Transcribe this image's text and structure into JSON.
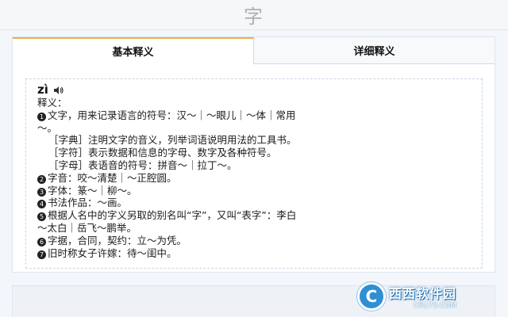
{
  "header": {
    "title": "字"
  },
  "tabs": [
    {
      "label": "基本释义",
      "active": true
    },
    {
      "label": "详细释义",
      "active": false
    }
  ],
  "entry": {
    "pinyin": "zì",
    "sound_icon": "speaker-icon",
    "definition_label": "释义：",
    "lines": [
      {
        "num": "1",
        "text": "文字，用来记录语言的符号：汉～｜～眼儿｜～体｜常用"
      },
      {
        "num": "",
        "text": "～。"
      },
      {
        "num": "",
        "sub": true,
        "text": "［字典］注明文字的音义，列举词语说明用法的工具书。"
      },
      {
        "num": "",
        "sub": true,
        "text": "［字符］表示数据和信息的字母、数字及各种符号。"
      },
      {
        "num": "",
        "sub": true,
        "text": "［字母］表语音的符号：拼音～｜拉丁～。"
      },
      {
        "num": "2",
        "text": "字音：咬～清楚｜～正腔圆。"
      },
      {
        "num": "3",
        "text": "字体：篆～｜柳～。"
      },
      {
        "num": "4",
        "text": "书法作品：～画。"
      },
      {
        "num": "5",
        "text": "根据人名中的字义另取的别名叫“字”，又叫“表字”：李白"
      },
      {
        "num": "",
        "text": "～太白｜岳飞～鹏举。"
      },
      {
        "num": "6",
        "text": "字据，合同，契约：立～为凭。"
      },
      {
        "num": "7",
        "text": "旧时称女子许嫁：待～闺中。"
      }
    ]
  },
  "watermark": {
    "logo_letter": "C",
    "main": "西西软件园",
    "sub": "CR173.COM"
  },
  "colors": {
    "tab_accent": "#e9b14a",
    "watermark_blue": "#2f8fd3"
  }
}
